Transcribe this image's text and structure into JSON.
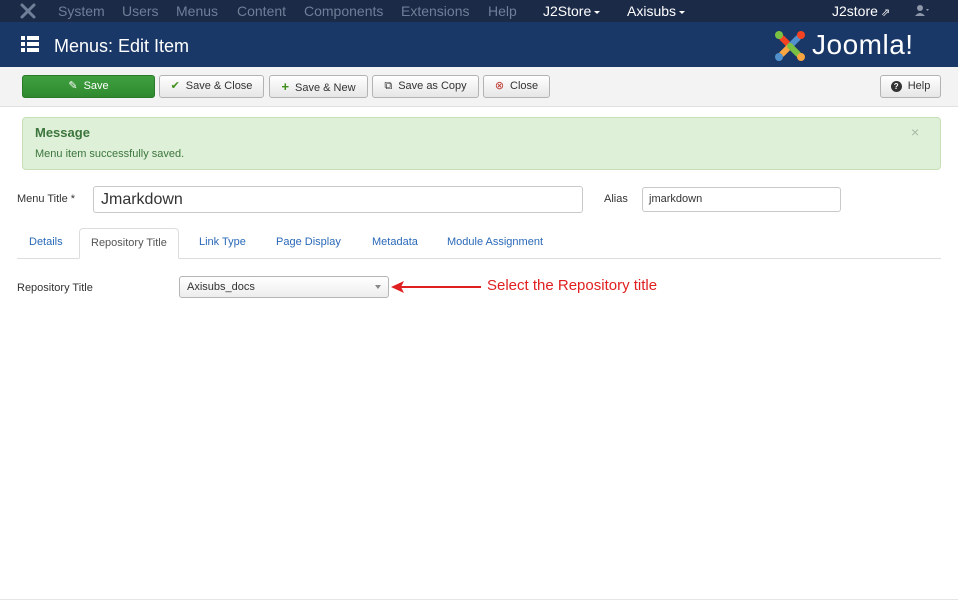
{
  "topnav": {
    "logo_icon": "joomla-x-icon",
    "items": [
      "System",
      "Users",
      "Menus",
      "Content",
      "Components",
      "Extensions",
      "Help"
    ],
    "j2store_menu": "J2Store",
    "axisubs_menu": "Axisubs",
    "site_link": "J2store",
    "site_link_icon": "external-link-icon",
    "user_icon": "user-icon"
  },
  "header": {
    "title": "Menus: Edit Item",
    "logo_text": "Joomla!",
    "menu_icon": "list-icon"
  },
  "toolbar": {
    "save": "Save",
    "save_close": "Save & Close",
    "save_new": "Save & New",
    "save_copy": "Save as Copy",
    "close": "Close",
    "help": "Help"
  },
  "message": {
    "heading": "Message",
    "text": "Menu item successfully saved.",
    "close_symbol": "×"
  },
  "form": {
    "menu_title_label": "Menu Title *",
    "menu_title_value": "Jmarkdown",
    "alias_label": "Alias",
    "alias_value": "jmarkdown"
  },
  "tabs": [
    "Details",
    "Repository Title",
    "Link Type",
    "Page Display",
    "Metadata",
    "Module Assignment"
  ],
  "active_tab": "Repository Title",
  "field": {
    "label": "Repository Title",
    "selected": "Axisubs_docs"
  },
  "annotation": {
    "text": "Select the Repository title",
    "color": "#e02020"
  },
  "colors": {
    "navbar": "#1b2a47",
    "header": "#1a3867",
    "save_button": "#3fa03f",
    "message_bg": "#dff0d8",
    "link": "#2a69b8"
  }
}
